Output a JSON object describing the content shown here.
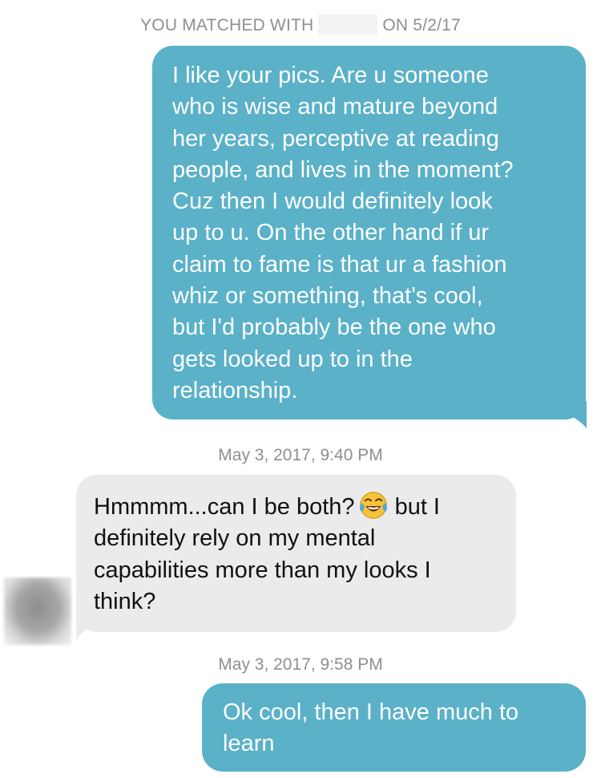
{
  "header": {
    "matched_prefix": "YOU MATCHED WITH",
    "matched_suffix": "ON 5/2/17"
  },
  "messages": [
    {
      "sender": "me",
      "lines": [
        "I like your pics. Are u someone",
        "who is wise and mature beyond",
        "her years, perceptive at reading",
        "people, and lives in the moment?",
        "Cuz then I would definitely look",
        "up to u. On the other hand if ur",
        "claim to fame is that ur a fashion",
        "whiz or something, that's cool,",
        "but I'd probably be the one who",
        "gets looked up to in the",
        "relationship."
      ]
    },
    {
      "timestamp": "May 3, 2017, 9:40 PM"
    },
    {
      "sender": "them",
      "line1_before_emoji": "Hmmmm...can I be both?",
      "emoji": "face-with-tears-of-joy",
      "line1_after_emoji": "but I",
      "lines": [
        "definitely rely on my mental",
        "capabilities more than my looks I",
        "think?"
      ]
    },
    {
      "timestamp": "May 3, 2017, 9:58 PM"
    },
    {
      "sender": "me",
      "lines": [
        "Ok cool, then I have much to",
        "learn"
      ]
    }
  ],
  "colors": {
    "outgoing_bubble": "#5ab1c8",
    "incoming_bubble": "#ebebeb",
    "meta_text": "#8f8f8f"
  }
}
